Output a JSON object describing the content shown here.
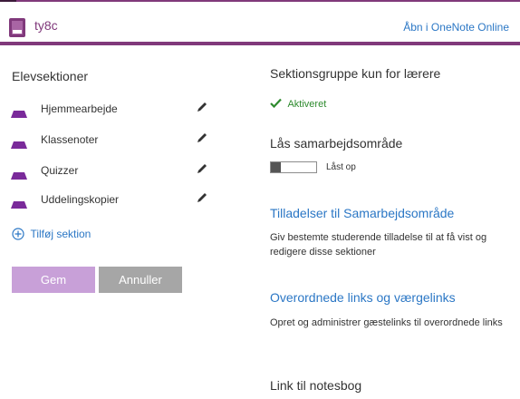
{
  "notebook": {
    "title": "ty8c",
    "open_online_label": "Åbn i OneNote Online",
    "brand_color": "#80397b",
    "link_color": "#2b77c5"
  },
  "student_sections": {
    "heading": "Elevsektioner",
    "items": [
      {
        "label": "Hjemmearbejde",
        "icon": "section-tab-icon",
        "action_icon": "pencil-icon"
      },
      {
        "label": "Klassenoter",
        "icon": "section-tab-icon",
        "action_icon": "pencil-icon"
      },
      {
        "label": "Quizzer",
        "icon": "section-tab-icon",
        "action_icon": "pencil-icon"
      },
      {
        "label": "Uddelingskopier",
        "icon": "section-tab-icon",
        "action_icon": "pencil-icon"
      }
    ],
    "add_label": "Tilføj sektion",
    "add_icon": "plus-circle-icon"
  },
  "buttons": {
    "save_label": "Gem",
    "cancel_label": "Annuller"
  },
  "teacher_only": {
    "heading": "Sektionsgruppe kun for lærere",
    "status_label": "Aktiveret",
    "status_icon": "checkmark-icon",
    "status_color": "#2e8b2e"
  },
  "lock_collab": {
    "heading": "Lås samarbejdsområde",
    "toggle_label": "Låst op",
    "toggle_on": false
  },
  "collab_permissions": {
    "heading": "Tilladelser til Samarbejdsområde",
    "description": "Giv bestemte studerende tilladelse til at få vist og redigere disse sektioner"
  },
  "parent_links": {
    "heading": "Overordnede links og værgelinks",
    "description": "Opret og administrer gæstelinks til overordnede links"
  },
  "notebook_link": {
    "heading": "Link til notesbog"
  }
}
